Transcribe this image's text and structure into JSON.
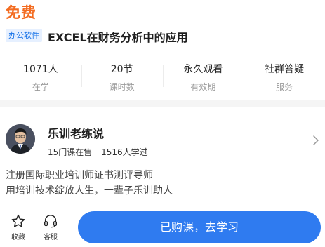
{
  "course": {
    "price_label": "免费",
    "category_tag": "办公软件",
    "title": "EXCEL在财务分析中的应用",
    "stats": [
      {
        "value": "1071人",
        "label": "在学"
      },
      {
        "value": "20节",
        "label": "课时数"
      },
      {
        "value": "永久观看",
        "label": "有效期"
      },
      {
        "value": "社群答疑",
        "label": "服务"
      }
    ]
  },
  "teacher": {
    "name": "乐训老练说",
    "courses_on_sale": "15门课在售",
    "students_learned": "1516人学过",
    "bio_lines": [
      "注册国际职业培训师证书测评导师",
      "用培训技术绽放人生，一辈子乐训助人"
    ]
  },
  "bottom_bar": {
    "favorite_label": "收藏",
    "service_label": "客服",
    "cta_label": "已购课，去学习"
  },
  "colors": {
    "price": "#f36c21",
    "accent": "#2f7bf0",
    "tag_bg": "#e6f0ff",
    "tag_text": "#1a74e8"
  },
  "icons": {
    "favorite": "star-icon",
    "service": "headset-icon",
    "teacher_link": "chevron-right-icon"
  }
}
